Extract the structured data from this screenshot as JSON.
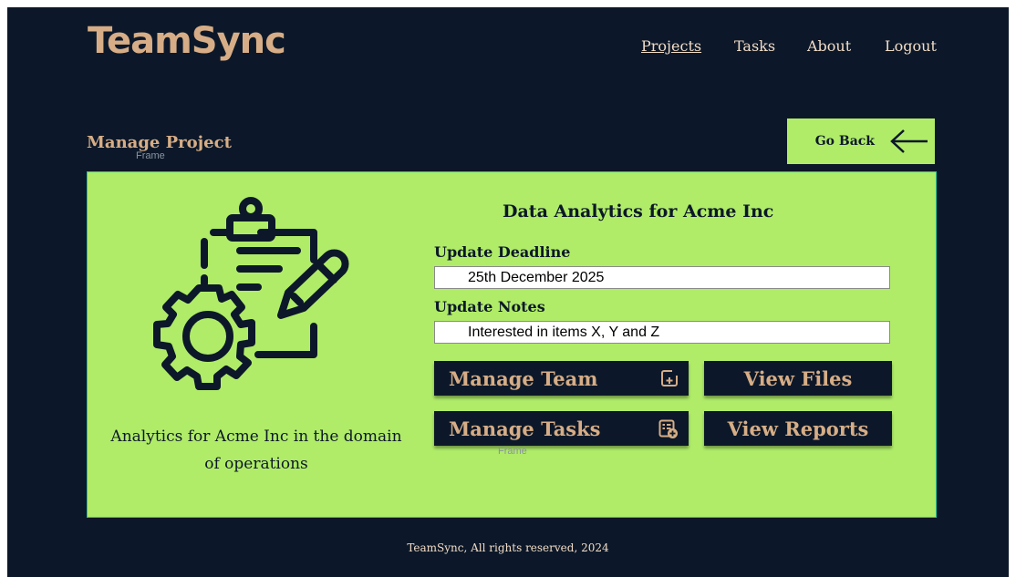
{
  "app": {
    "logo": "TeamSync"
  },
  "nav": {
    "projects": "Projects",
    "tasks": "Tasks",
    "about": "About",
    "logout": "Logout"
  },
  "page": {
    "title": "Manage Project",
    "go_back": "Go Back"
  },
  "placeholders": {
    "frame_label_1": "Frame",
    "frame_label_2": "Frame"
  },
  "project": {
    "title": "Data Analytics for Acme Inc",
    "description": "Analytics for Acme Inc in the domain of operations",
    "deadline_label": "Update Deadline",
    "deadline_value": "25th December 2025",
    "notes_label": "Update Notes",
    "notes_value": "Interested in items X, Y and Z"
  },
  "actions": {
    "manage_team": "Manage Team",
    "view_files": "View Files",
    "manage_tasks": "Manage Tasks",
    "view_reports": "View Reports"
  },
  "icons": {
    "illustration": "clipboard-gear-pencil-icon",
    "go_back": "arrow-left-icon",
    "manage_team": "add-box-icon",
    "manage_tasks": "task-list-add-icon"
  },
  "colors": {
    "background": "#0c1829",
    "accent": "#b0ec68",
    "brand": "#d6ad86",
    "panel_border": "#25c59b"
  },
  "footer": {
    "text": "TeamSync, All rights reserved, 2024"
  }
}
